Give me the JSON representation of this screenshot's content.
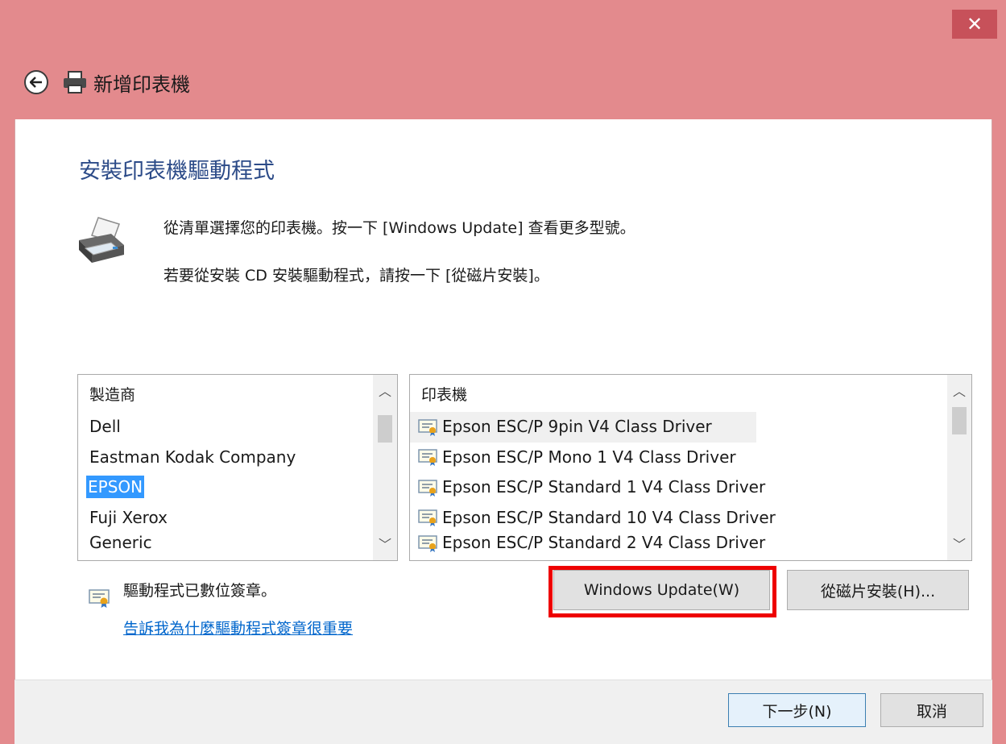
{
  "window": {
    "close_glyph": "✕",
    "title": "新增印表機",
    "accent_color": "#e38a8d"
  },
  "main": {
    "heading": "安裝印表機驅動程式",
    "instruction_1": "從清單選擇您的印表機。按一下 [Windows Update] 查看更多型號。",
    "instruction_2": "若要從安裝 CD 安裝驅動程式，請按一下 [從磁片安裝]。"
  },
  "manufacturer_list": {
    "header": "製造商",
    "items": [
      "Dell",
      "Eastman Kodak Company",
      "EPSON",
      "Fuji Xerox",
      "Generic"
    ],
    "selected": "EPSON"
  },
  "printer_list": {
    "header": "印表機",
    "items": [
      "Epson ESC/P 9pin V4 Class Driver",
      "Epson ESC/P Mono 1 V4 Class Driver",
      "Epson ESC/P Standard 1 V4 Class Driver",
      "Epson ESC/P Standard 10 V4 Class Driver",
      "Epson ESC/P Standard 2 V4 Class Driver"
    ],
    "selected": "Epson ESC/P 9pin V4 Class Driver"
  },
  "signature": {
    "status": "驅動程式已數位簽章。",
    "link": "告訴我為什麼驅動程式簽章很重要"
  },
  "buttons": {
    "windows_update": "Windows Update(W)",
    "have_disk": "從磁片安裝(H)...",
    "next": "下一步(N)",
    "cancel": "取消"
  }
}
